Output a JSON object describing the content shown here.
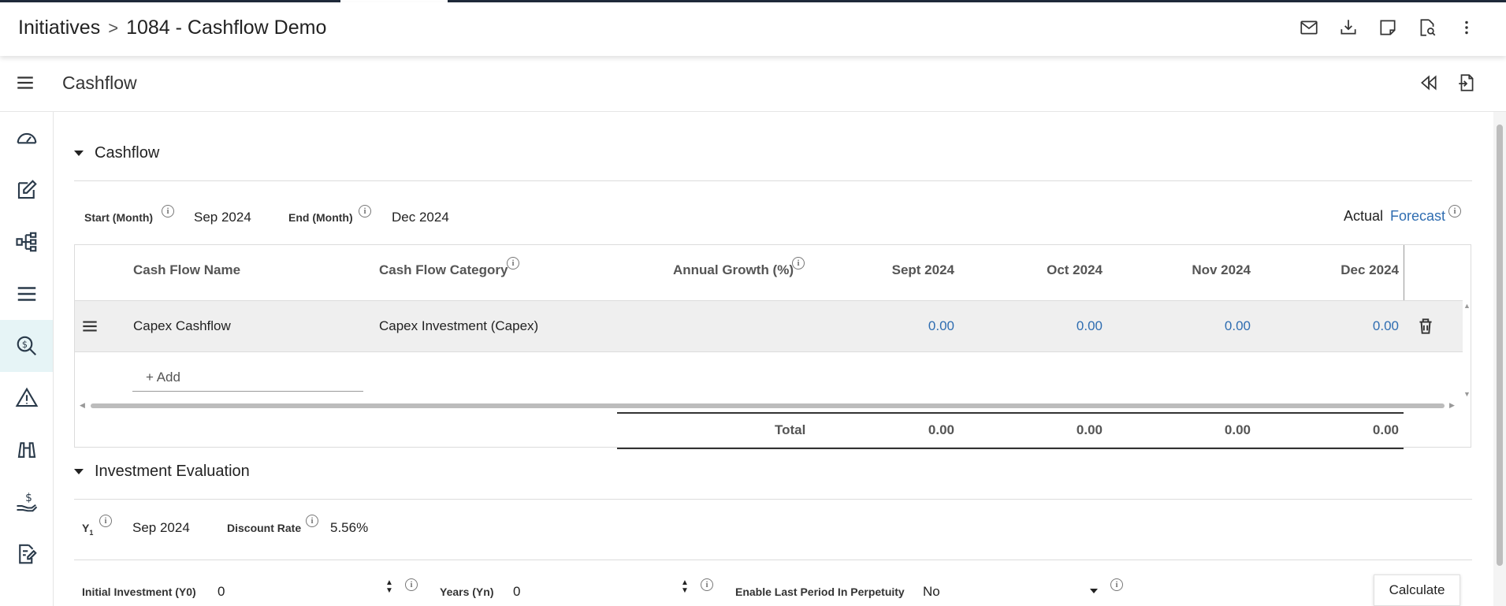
{
  "breadcrumb": {
    "root": "Initiatives",
    "separator": ">",
    "current": "1084 - Cashflow Demo"
  },
  "subbar": {
    "title": "Cashflow"
  },
  "cashflow_section": {
    "title": "Cashflow",
    "start_label": "Start (Month)",
    "start_value": "Sep 2024",
    "end_label": "End (Month)",
    "end_value": "Dec 2024",
    "actual_label": "Actual",
    "forecast_label": "Forecast"
  },
  "grid": {
    "headers": {
      "name": "Cash Flow Name",
      "category": "Cash Flow Category",
      "growth": "Annual Growth (%)",
      "m1": "Sept 2024",
      "m2": "Oct 2024",
      "m3": "Nov 2024",
      "m4": "Dec 2024"
    },
    "rows": [
      {
        "name": "Capex Cashflow",
        "category": "Capex Investment (Capex)",
        "growth": "",
        "m1": "0.00",
        "m2": "0.00",
        "m3": "0.00",
        "m4": "0.00"
      }
    ],
    "add_label": "+ Add",
    "total": {
      "label": "Total",
      "m1": "0.00",
      "m2": "0.00",
      "m3": "0.00",
      "m4": "0.00"
    }
  },
  "investment_section": {
    "title": "Investment Evaluation",
    "y1_label": "Y",
    "y1_sub": "1",
    "y1_value": "Sep 2024",
    "discount_label": "Discount Rate",
    "discount_value": "5.56%",
    "initial_label": "Initial Investment (Y0)",
    "initial_value": "0",
    "years_label": "Years (Yn)",
    "years_value": "0",
    "perpetuity_label": "Enable Last Period In Perpetuity",
    "perpetuity_value": "No",
    "calculate_label": "Calculate"
  }
}
